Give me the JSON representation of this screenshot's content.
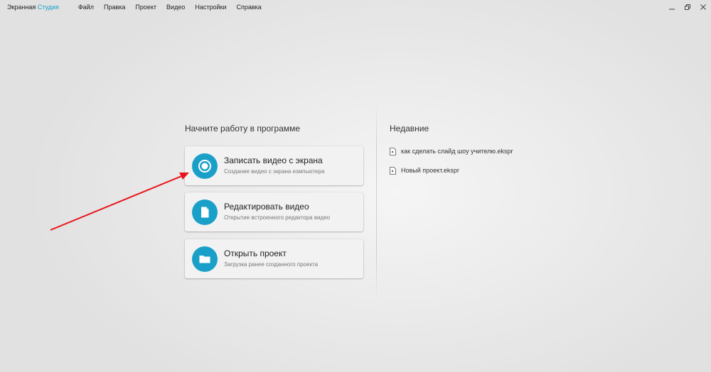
{
  "app": {
    "title_main": "Экранная",
    "title_accent": "Студия",
    "accent_color": "#1aa0c8"
  },
  "menu": [
    {
      "label": "Файл"
    },
    {
      "label": "Правка"
    },
    {
      "label": "Проект"
    },
    {
      "label": "Видео"
    },
    {
      "label": "Настройки"
    },
    {
      "label": "Справка"
    }
  ],
  "window_controls": [
    "minimize-icon",
    "restore-icon",
    "close-icon"
  ],
  "start": {
    "heading": "Начните работу в программе",
    "actions": [
      {
        "title": "Записать видео с экрана",
        "subtitle": "Создание видео с экрана компьютера",
        "icon": "record-icon"
      },
      {
        "title": "Редактировать видео",
        "subtitle": "Открытие встроенного редактора видео",
        "icon": "document-icon"
      },
      {
        "title": "Открыть проект",
        "subtitle": "Загрузка ранее созданного проекта",
        "icon": "folder-icon"
      }
    ]
  },
  "recent": {
    "heading": "Недавние",
    "items": [
      {
        "name": "как сделать слайд шоу учителю.ekspr",
        "icon": "file-icon"
      },
      {
        "name": "Новый проект.ekspr",
        "icon": "file-icon"
      }
    ]
  },
  "annotation": {
    "arrow_color": "#e8141b"
  }
}
